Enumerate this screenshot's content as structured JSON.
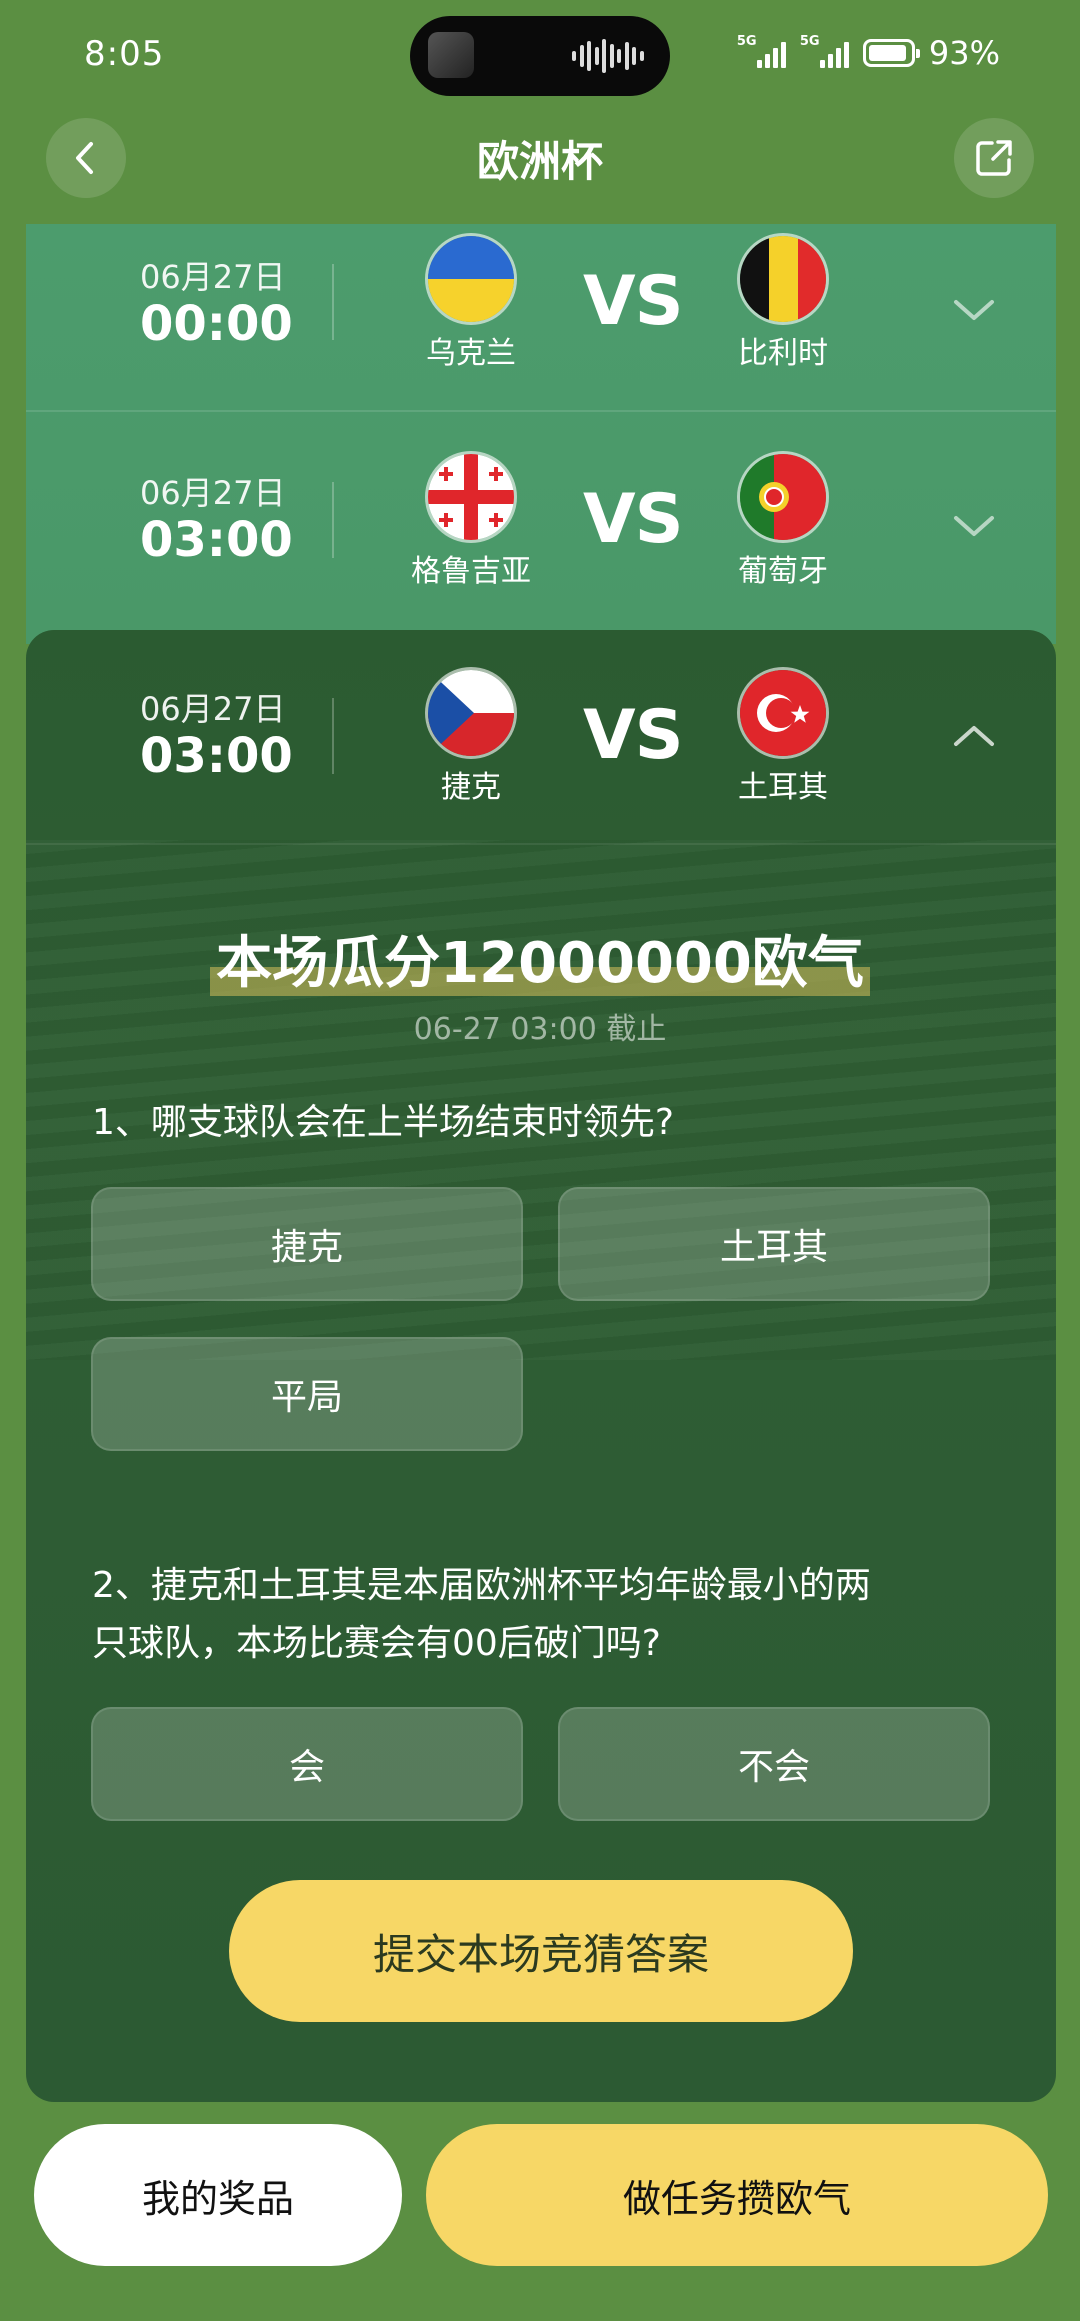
{
  "status_bar": {
    "time": "8:05",
    "network1": "5G",
    "network2": "5G",
    "battery": "93%",
    "battery_level": 0.93
  },
  "header": {
    "title": "欧洲杯",
    "back_icon": "chevron-left-icon",
    "share_icon": "share-icon"
  },
  "vs_label": "VS",
  "matches": [
    {
      "date": "06月27日",
      "time": "00:00",
      "home": "乌克兰",
      "away": "比利时",
      "expanded": false
    },
    {
      "date": "06月27日",
      "time": "03:00",
      "home": "格鲁吉亚",
      "away": "葡萄牙",
      "expanded": false
    },
    {
      "date": "06月27日",
      "time": "03:00",
      "home": "捷克",
      "away": "土耳其",
      "expanded": true
    }
  ],
  "quiz": {
    "headline": "本场瓜分12000000欧气",
    "deadline": "06-27 03:00 截止",
    "questions": [
      {
        "text": "1、哪支球队会在上半场结束时领先?",
        "options": [
          "捷克",
          "土耳其",
          "平局"
        ]
      },
      {
        "text_line1": "2、捷克和土耳其是本届欧洲杯平均年龄最小的两",
        "text_line2": "只球队，本场比赛会有00后破门吗?",
        "options": [
          "会",
          "不会"
        ]
      }
    ],
    "submit_label": "提交本场竞猜答案"
  },
  "bottom": {
    "prizes_label": "我的奖品",
    "tasks_label": "做任务攒欧气"
  },
  "colors": {
    "background": "#5b8f42",
    "accent_yellow": "#f7d766",
    "card_light": "#4c9c6d",
    "card_dark": "#2b5b31"
  }
}
